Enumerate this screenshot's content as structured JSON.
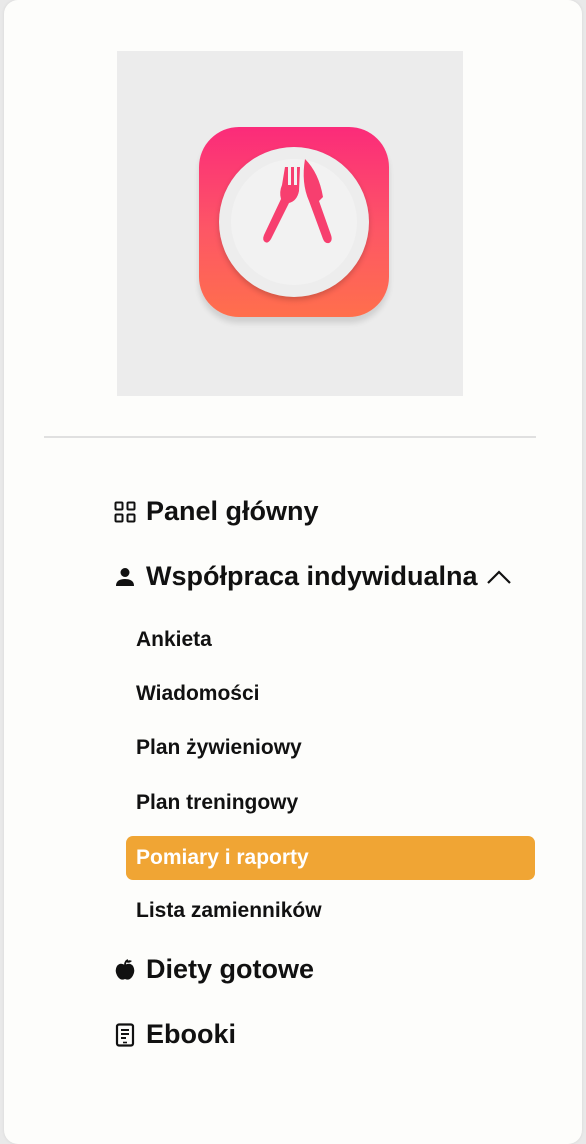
{
  "logo": {
    "icon": "fork-knife-plate-icon",
    "colors": {
      "top": "#fb2b7a",
      "bottom": "#ff6f4c"
    }
  },
  "nav": {
    "dashboard": {
      "label": "Panel główny",
      "icon": "grid-icon"
    },
    "individual": {
      "label": "Współpraca indywidualna",
      "icon": "person-icon",
      "expanded": true,
      "subitems": [
        {
          "label": "Ankieta"
        },
        {
          "label": "Wiadomości"
        },
        {
          "label": "Plan żywieniowy"
        },
        {
          "label": "Plan treningowy"
        },
        {
          "label": "Pomiary i raporty",
          "active": true
        },
        {
          "label": "Lista zamienników"
        }
      ]
    },
    "ready_diets": {
      "label": "Diety gotowe",
      "icon": "apple-icon"
    },
    "ebooks": {
      "label": "Ebooki",
      "icon": "ebook-icon"
    }
  },
  "colors": {
    "active_bg": "#f0a534",
    "active_text": "#ffffff"
  }
}
